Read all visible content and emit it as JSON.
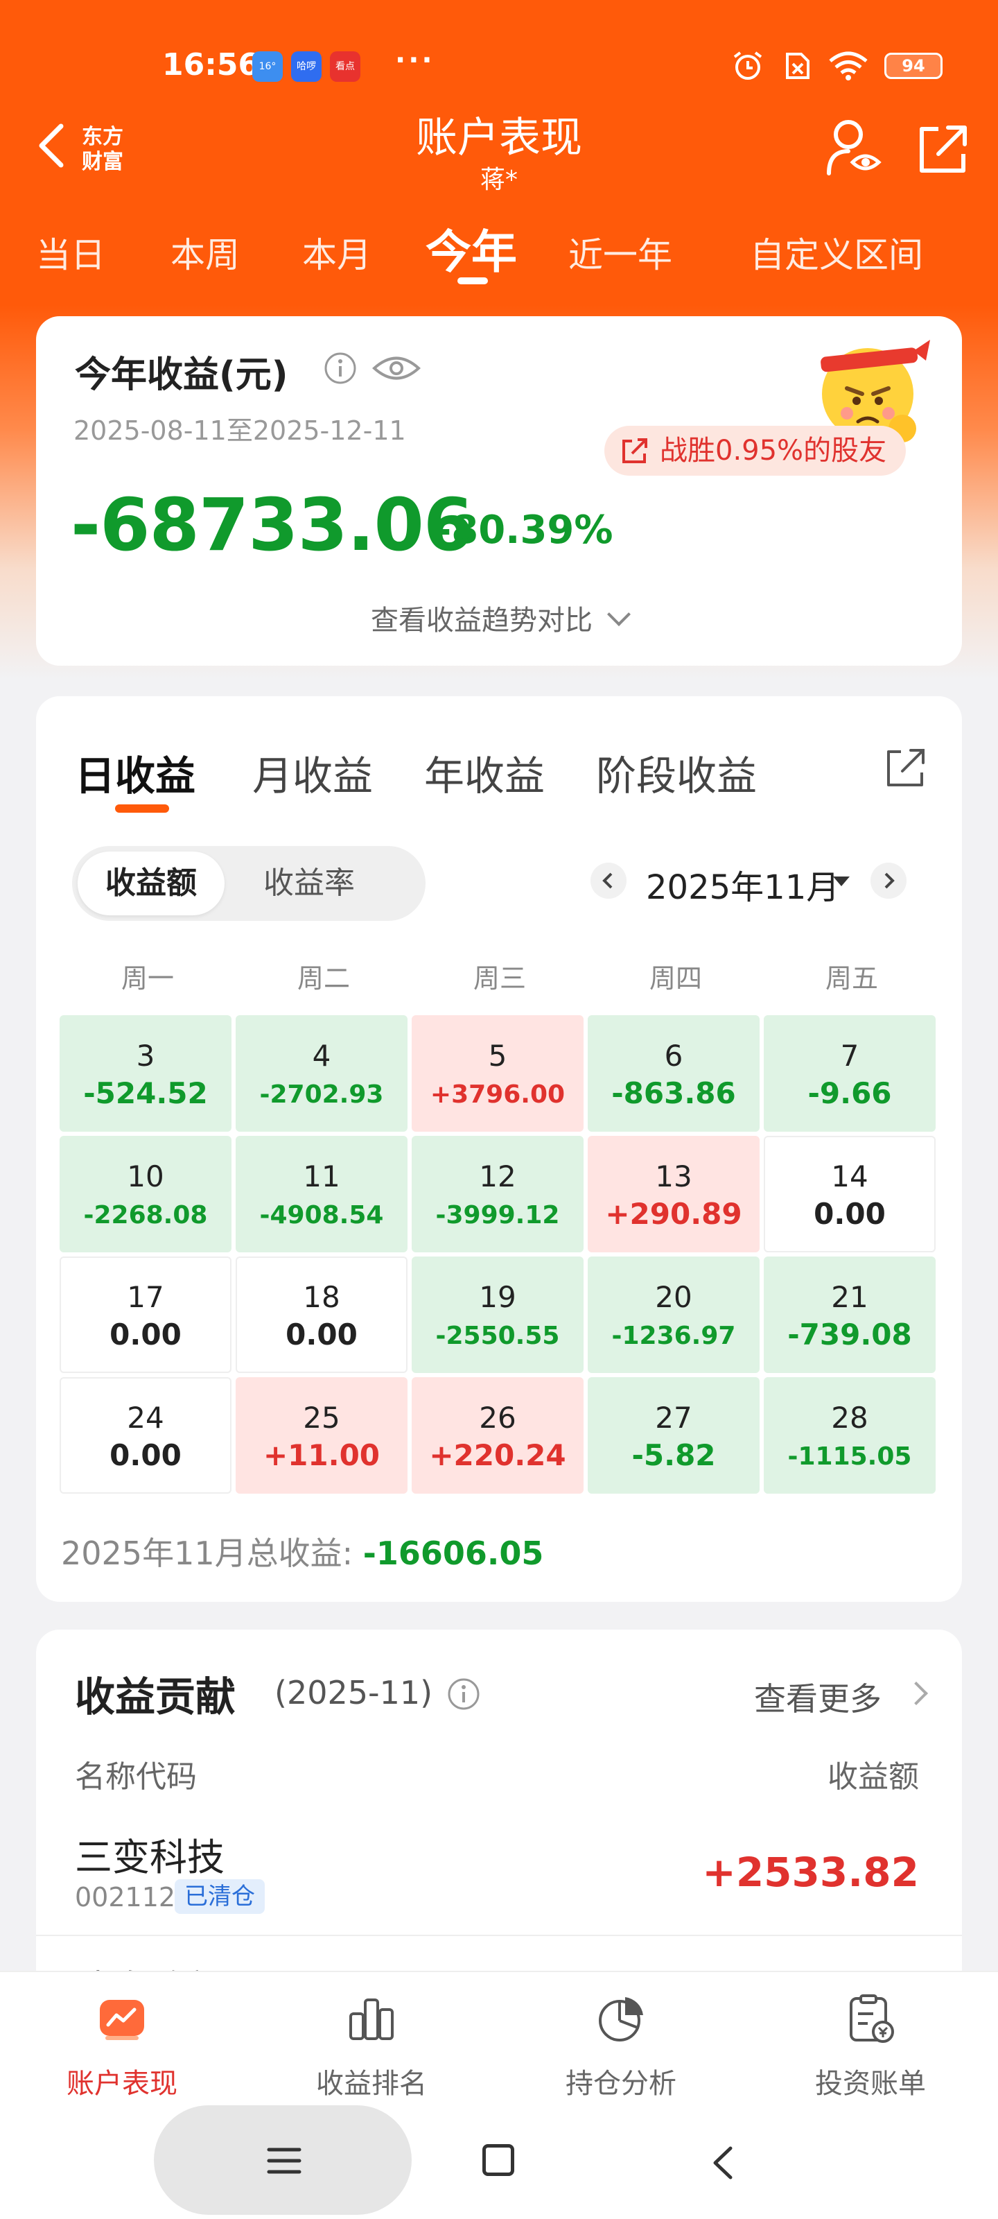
{
  "status_bar": {
    "time": "16:56",
    "apps": [
      {
        "label": "16°",
        "color": "#3d8ef0"
      },
      {
        "label": "哈啰",
        "color": "#2f6df0"
      },
      {
        "label": "看点",
        "color": "#e8322e"
      }
    ],
    "more": "···",
    "battery": "94"
  },
  "nav": {
    "brand_line1": "东方",
    "brand_line2": "财富",
    "title": "账户表现",
    "subtitle": "蒋*"
  },
  "period_tabs": [
    "当日",
    "本周",
    "本月",
    "今年",
    "近一年",
    "自定义区间"
  ],
  "active_period": "今年",
  "summary": {
    "title": "今年收益(元)",
    "date_range": "2025-08-11至2025-12-11",
    "beat_text": "战胜0.95%的股友",
    "amount": "-68733.06",
    "percent": "-80.39%",
    "trend_link": "查看收益趋势对比"
  },
  "earnings": {
    "tabs": [
      "日收益",
      "月收益",
      "年收益",
      "阶段收益"
    ],
    "active_tab": "日收益",
    "segments": [
      "收益额",
      "收益率"
    ],
    "active_segment": "收益额",
    "month": "2025年11月",
    "weekdays": [
      "周一",
      "周二",
      "周三",
      "周四",
      "周五"
    ],
    "rows": [
      [
        {
          "day": "3",
          "value": "-524.52",
          "kind": "loss"
        },
        {
          "day": "4",
          "value": "-2702.93",
          "kind": "loss"
        },
        {
          "day": "5",
          "value": "+3796.00",
          "kind": "gain"
        },
        {
          "day": "6",
          "value": "-863.86",
          "kind": "loss"
        },
        {
          "day": "7",
          "value": "-9.66",
          "kind": "loss"
        }
      ],
      [
        {
          "day": "10",
          "value": "-2268.08",
          "kind": "loss"
        },
        {
          "day": "11",
          "value": "-4908.54",
          "kind": "loss"
        },
        {
          "day": "12",
          "value": "-3999.12",
          "kind": "loss"
        },
        {
          "day": "13",
          "value": "+290.89",
          "kind": "gain"
        },
        {
          "day": "14",
          "value": "0.00",
          "kind": "flat"
        }
      ],
      [
        {
          "day": "17",
          "value": "0.00",
          "kind": "flat"
        },
        {
          "day": "18",
          "value": "0.00",
          "kind": "flat"
        },
        {
          "day": "19",
          "value": "-2550.55",
          "kind": "loss"
        },
        {
          "day": "20",
          "value": "-1236.97",
          "kind": "loss"
        },
        {
          "day": "21",
          "value": "-739.08",
          "kind": "loss"
        }
      ],
      [
        {
          "day": "24",
          "value": "0.00",
          "kind": "flat"
        },
        {
          "day": "25",
          "value": "+11.00",
          "kind": "gain"
        },
        {
          "day": "26",
          "value": "+220.24",
          "kind": "gain"
        },
        {
          "day": "27",
          "value": "-5.82",
          "kind": "loss"
        },
        {
          "day": "28",
          "value": "-1115.05",
          "kind": "loss"
        }
      ]
    ],
    "total_label": "2025年11月总收益: ",
    "total_value": "-16606.05"
  },
  "contribution": {
    "title": "收益贡献",
    "period": "(2025-11)",
    "more": "查看更多",
    "col_name": "名称代码",
    "col_value": "收益额",
    "items": [
      {
        "name": "三变科技",
        "code": "002112",
        "tag": "已清仓",
        "value": "+2533.82"
      },
      {
        "name": "建发致新"
      }
    ]
  },
  "bottom_nav": [
    {
      "label": "账户表现",
      "icon": "chart-up-icon"
    },
    {
      "label": "收益排名",
      "icon": "bar-chart-icon"
    },
    {
      "label": "持仓分析",
      "icon": "pie-chart-icon"
    },
    {
      "label": "投资账单",
      "icon": "bill-icon"
    }
  ],
  "colors": {
    "brand": "#ff5a0a",
    "gain": "#e0322e",
    "loss": "#109a2c",
    "gain_bg": "#ffe4e2",
    "loss_bg": "#dff3e4"
  }
}
